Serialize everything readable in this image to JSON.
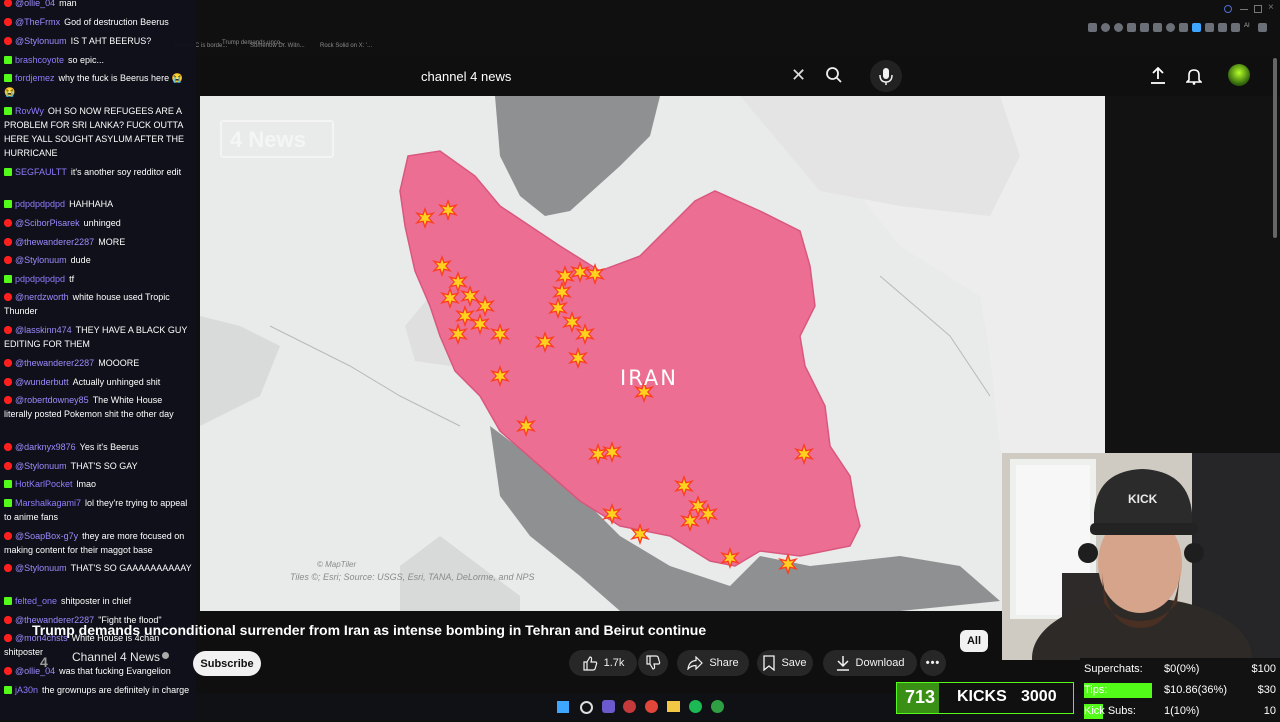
{
  "browser": {
    "tab_titles": [
      "Trump demands unco...",
      "Tommy C is borde...",
      "Somehow Dr. Witn...",
      "Rock Solid on X: '..."
    ]
  },
  "search": {
    "value": "channel 4 news",
    "placeholder": "Search"
  },
  "video": {
    "title": "Trump demands unconditional surrender from Iran as intense bombing in Tehran and Beirut continue",
    "channel": "Channel 4 News",
    "subscribe_label": "Subscribe",
    "likes": "1.7k",
    "share_label": "Share",
    "save_label": "Save",
    "download_label": "Download",
    "filter_chip": "All",
    "map": {
      "country_label": "IRAN",
      "watermark": "4 News",
      "credit_logo": "© MapTiler",
      "credit_source": "Tiles ©; Esri; Source: USGS, Esri, TANA, DeLorme, and NPS"
    }
  },
  "chat": {
    "messages": [
      {
        "platform": "youtube",
        "user": "@ollie_04",
        "text": "man"
      },
      {
        "platform": "youtube",
        "user": "@TheFrmx",
        "text": "God of destruction Beerus"
      },
      {
        "platform": "youtube",
        "user": "@Stylonuum",
        "text": "IS T AHT BEERUS?"
      },
      {
        "platform": "kick",
        "user": "brashcoyote",
        "text": "so epic..."
      },
      {
        "platform": "kick",
        "user": "fordjemez",
        "text": "why the fuck is Beerus here 😭😭"
      },
      {
        "platform": "kick",
        "user": "RovWy",
        "text": "OH SO NOW REFUGEES ARE A PROBLEM FOR SRI LANKA? FUCK OUTTA HERE YALL SOUGHT ASYLUM AFTER THE HURRICANE"
      },
      {
        "platform": "kick",
        "user": "SEGFAULTT",
        "text": "it's another soy redditor edit"
      },
      {
        "platform": "kick",
        "user": "pdpdpdpdpd",
        "text": "HAHHAHA"
      },
      {
        "platform": "youtube",
        "user": "@SciborPisarek",
        "text": "unhinged"
      },
      {
        "platform": "youtube",
        "user": "@thewanderer2287",
        "text": "MORE"
      },
      {
        "platform": "youtube",
        "user": "@Stylonuum",
        "text": "dude"
      },
      {
        "platform": "kick",
        "user": "pdpdpdpdpd",
        "text": "tf"
      },
      {
        "platform": "youtube",
        "user": "@nerdzworth",
        "text": "white house used Tropic Thunder"
      },
      {
        "platform": "youtube",
        "user": "@lasskinn474",
        "text": "THEY HAVE A BLACK GUY EDITING FOR THEM"
      },
      {
        "platform": "youtube",
        "user": "@thewanderer2287",
        "text": "MOOORE"
      },
      {
        "platform": "youtube",
        "user": "@wunderbutt",
        "text": "Actually unhinged shit"
      },
      {
        "platform": "youtube",
        "user": "@robertdowney85",
        "text": "The White House literally posted Pokemon shit the other day"
      },
      {
        "platform": "youtube",
        "user": "@darknyx9876",
        "text": "Yes it's Beerus"
      },
      {
        "platform": "youtube",
        "user": "@Stylonuum",
        "text": "THAT'S SO GAY"
      },
      {
        "platform": "kick",
        "user": "HotKarlPocket",
        "text": "lmao"
      },
      {
        "platform": "kick",
        "user": "Marshalkagami7",
        "text": "lol they're trying to appeal to anime fans"
      },
      {
        "platform": "youtube",
        "user": "@SoapBox-g7y",
        "text": "they are more focused on making content for their maggot base"
      },
      {
        "platform": "youtube",
        "user": "@Stylonuum",
        "text": "THAT'S SO GAAAAAAAAAAY"
      },
      {
        "platform": "kick",
        "user": "felted_one",
        "text": "shitposter in chief"
      },
      {
        "platform": "youtube",
        "user": "@thewanderer2287",
        "text": "\"Fight the flood\""
      },
      {
        "platform": "youtube",
        "user": "@mon4chsts",
        "text": "White House is 4chan shitposter"
      },
      {
        "platform": "youtube",
        "user": "@ollie_04",
        "text": "was that fucking Evangelion"
      },
      {
        "platform": "kick",
        "user": "jA30n",
        "text": "the grownups are definitely in charge"
      }
    ]
  },
  "overlay": {
    "kicks_count": "713",
    "kicks_label": "KICKS",
    "kicks_goal": "3000",
    "stats": [
      {
        "label": "Superchats:",
        "value": "$0(0%)",
        "goal": "$100",
        "fill": 0.0
      },
      {
        "label": "Tips:",
        "value": "$10.86(36%)",
        "goal": "$30",
        "fill": 0.36
      },
      {
        "label": "Kick Subs:",
        "value": "1(10%)",
        "goal": "10",
        "fill": 0.1
      }
    ]
  },
  "colors": {
    "iran_fill": "#ec6f93",
    "kick_green": "#53fc18",
    "youtube_red": "#ff1f1f",
    "username_purple": "#9e8bff"
  }
}
